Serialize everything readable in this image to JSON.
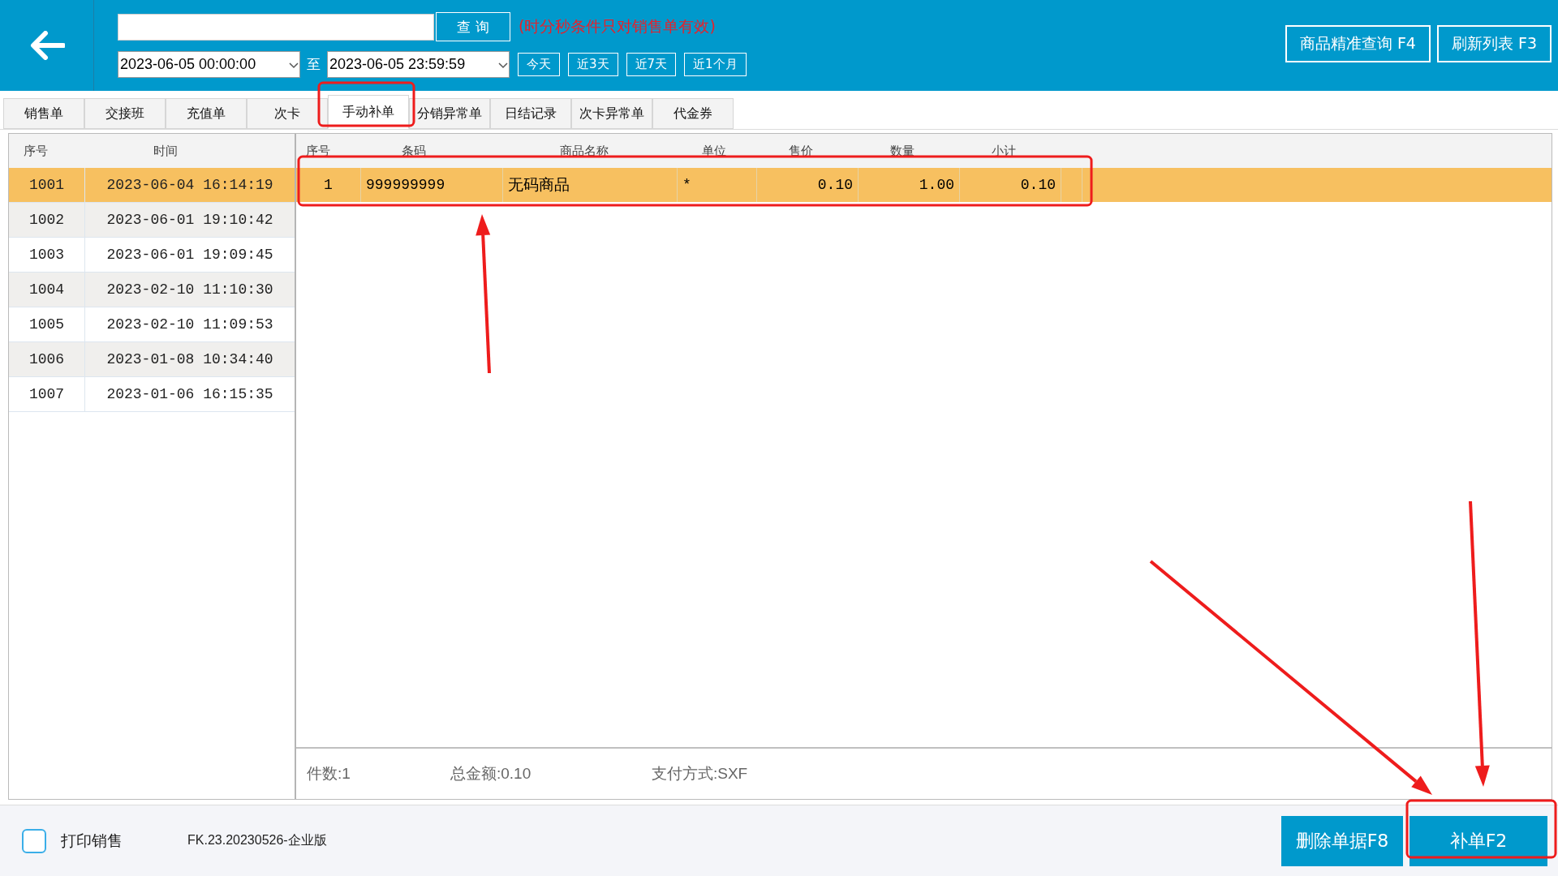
{
  "header": {
    "search_button": "查 询",
    "hint": "(时分秒条件只对销售单有效)",
    "date_from": "2023-06-05 00:00:00",
    "date_separator": "至",
    "date_to": "2023-06-05 23:59:59",
    "quick_ranges": [
      "今天",
      "近3天",
      "近7天",
      "近1个月"
    ],
    "actions": [
      "商品精准查询 F4",
      "刷新列表 F3"
    ]
  },
  "tabs": [
    {
      "label": "销售单",
      "selected": false
    },
    {
      "label": "交接班",
      "selected": false
    },
    {
      "label": "充值单",
      "selected": false
    },
    {
      "label": "次卡",
      "selected": false
    },
    {
      "label": "手动补单",
      "selected": true
    },
    {
      "label": "分销异常单",
      "selected": false
    },
    {
      "label": "日结记录",
      "selected": false
    },
    {
      "label": "次卡异常单",
      "selected": false
    },
    {
      "label": "代金券",
      "selected": false
    }
  ],
  "order_list": {
    "columns": [
      "序号",
      "时间"
    ],
    "rows": [
      {
        "id": "1001",
        "time": "2023-06-04 16:14:19",
        "selected": true
      },
      {
        "id": "1002",
        "time": "2023-06-01 19:10:42",
        "selected": false
      },
      {
        "id": "1003",
        "time": "2023-06-01 19:09:45",
        "selected": false
      },
      {
        "id": "1004",
        "time": "2023-02-10 11:10:30",
        "selected": false
      },
      {
        "id": "1005",
        "time": "2023-02-10 11:09:53",
        "selected": false
      },
      {
        "id": "1006",
        "time": "2023-01-08 10:34:40",
        "selected": false
      },
      {
        "id": "1007",
        "time": "2023-01-06 16:15:35",
        "selected": false
      }
    ]
  },
  "detail": {
    "columns": [
      "序号",
      "条码",
      "商品名称",
      "单位",
      "售价",
      "数量",
      "小计"
    ],
    "rows": [
      {
        "cells": [
          "1",
          "999999999",
          "无码商品",
          "*",
          "0.10",
          "1.00",
          "0.10"
        ],
        "selected": true
      }
    ],
    "summary": [
      "件数:1",
      "总金额:0.10",
      "支付方式:SXF"
    ]
  },
  "footer": {
    "print_checkbox": {
      "label": "打印销售",
      "checked": false
    },
    "version": "FK.23.20230526-企业版",
    "buttons": [
      "删除单据F8",
      "补单F2"
    ]
  },
  "annotations": [
    {
      "kind": "box"
    },
    {
      "kind": "box"
    },
    {
      "kind": "box"
    },
    {
      "kind": "arrow"
    },
    {
      "kind": "arrow"
    },
    {
      "kind": "arrow"
    }
  ]
}
